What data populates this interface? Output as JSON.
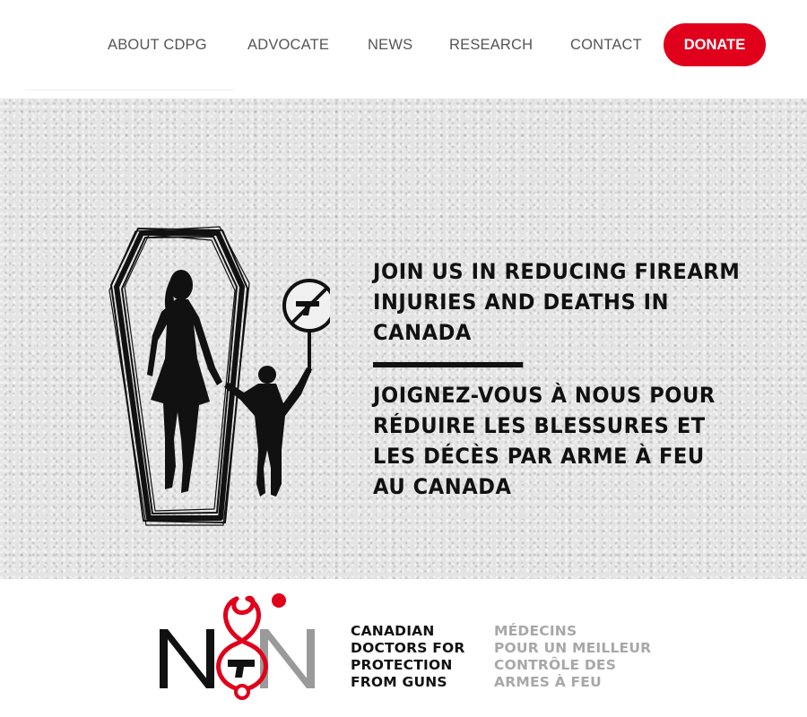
{
  "nav": {
    "items": [
      {
        "label": "ABOUT CDPG"
      },
      {
        "label": "ADVOCATE"
      },
      {
        "label": "NEWS"
      },
      {
        "label": "RESEARCH"
      },
      {
        "label": "CONTACT"
      }
    ],
    "donate_label": "DONATE"
  },
  "hero": {
    "headline_en": "JOIN US IN REDUCING FIREARM INJURIES AND DEATHS IN CANADA",
    "headline_fr": "JOIGNEZ-VOUS À NOUS POUR RÉDUIRE LES BLESSURES ET LES DÉCÈS PAR ARME À FEU AU CANADA"
  },
  "footer": {
    "logo_letters": "NON",
    "org_name_en": [
      "CANADIAN",
      "DOCTORS FOR",
      "PROTECTION",
      "FROM GUNS"
    ],
    "org_name_fr": [
      "MÉDECINS",
      "POUR UN MEILLEUR",
      "CONTRÔLE DES",
      "ARMES À FEU"
    ]
  },
  "colors": {
    "accent": "#e0001b",
    "nav_text": "#555555",
    "hero_bg": "#e4e4e4",
    "hero_text": "#111111",
    "org_fr_text": "#a8a8a8"
  },
  "icons": {
    "coffin": "coffin-illustration",
    "silhouette": "woman-and-child-silhouette",
    "no_guns_sign": "no-guns-icon",
    "logo": "stethoscope-logo"
  }
}
